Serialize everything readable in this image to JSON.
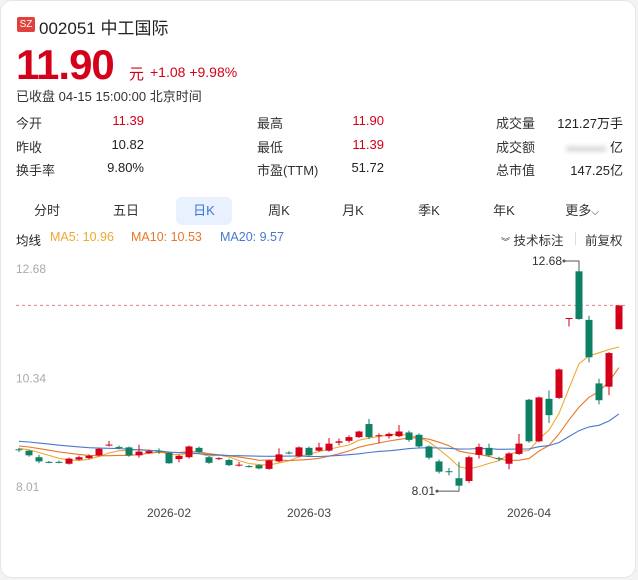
{
  "header": {
    "exchange": "SZ",
    "code": "002051",
    "name": "中工国际",
    "price": "11.90",
    "unit": "元",
    "change": "+1.08",
    "change_pct": "+9.98%",
    "status": "已收盘 04-15 15:00:00 北京时间"
  },
  "stats": [
    {
      "label": "今开",
      "value": "11.39",
      "color": "red"
    },
    {
      "label": "最高",
      "value": "11.90",
      "color": "red"
    },
    {
      "label": "成交量",
      "value": "121.27万手",
      "color": "plain"
    },
    {
      "label": "昨收",
      "value": "10.82",
      "color": "plain"
    },
    {
      "label": "最低",
      "value": "11.39",
      "color": "red"
    },
    {
      "label": "成交额",
      "value": "亿",
      "color": "plain"
    },
    {
      "label": "换手率",
      "value": "9.80%",
      "color": "plain"
    },
    {
      "label": "市盈(TTM)",
      "value": "51.72",
      "color": "plain"
    },
    {
      "label": "总市值",
      "value": "147.25亿",
      "color": "plain"
    }
  ],
  "tabs": [
    "分时",
    "五日",
    "日K",
    "周K",
    "月K",
    "季K",
    "年K",
    "更多"
  ],
  "selected_tab": "日K",
  "ma": {
    "label": "均线",
    "ma5": "MA5: 10.96",
    "ma10": "MA10: 10.53",
    "ma20": "MA20: 9.57",
    "tech": "技术标注",
    "adjust": "前复权"
  },
  "colors": {
    "up": "#d4001a",
    "down": "#0e8064",
    "ma5": "#f0a830",
    "ma10": "#e8782a",
    "ma20": "#4a78d0"
  },
  "chart_data": {
    "type": "candlestick",
    "ylim": [
      7.9,
      12.9
    ],
    "y_ticks": [
      "12.68",
      "10.34",
      "8.01"
    ],
    "x_ticks": [
      {
        "label": "2026-02",
        "index": 15
      },
      {
        "label": "2026-03",
        "index": 29
      },
      {
        "label": "2026-04",
        "index": 51
      }
    ],
    "last_close_line": 11.9,
    "annotations": [
      {
        "label": "12.68",
        "index": 56,
        "value": 12.68
      },
      {
        "label": "8.01",
        "index": 44,
        "value": 8.01
      }
    ],
    "ohlc": [
      [
        8.82,
        8.8,
        8.85,
        8.76
      ],
      [
        8.79,
        8.69,
        8.8,
        8.66
      ],
      [
        8.65,
        8.56,
        8.7,
        8.52
      ],
      [
        8.55,
        8.54,
        8.57,
        8.52
      ],
      [
        8.55,
        8.54,
        8.58,
        8.52
      ],
      [
        8.51,
        8.62,
        8.64,
        8.49
      ],
      [
        8.6,
        8.65,
        8.68,
        8.58
      ],
      [
        8.63,
        8.68,
        8.71,
        8.61
      ],
      [
        8.69,
        8.83,
        8.85,
        8.67
      ],
      [
        8.9,
        8.92,
        9.0,
        8.88
      ],
      [
        8.87,
        8.86,
        8.9,
        8.82
      ],
      [
        8.86,
        8.69,
        8.88,
        8.66
      ],
      [
        8.69,
        8.77,
        8.92,
        8.64
      ],
      [
        8.74,
        8.78,
        8.81,
        8.72
      ],
      [
        8.79,
        8.78,
        8.84,
        8.72
      ],
      [
        8.74,
        8.52,
        8.76,
        8.51
      ],
      [
        8.61,
        8.68,
        8.7,
        8.54
      ],
      [
        8.65,
        8.88,
        8.9,
        8.62
      ],
      [
        8.85,
        8.76,
        8.88,
        8.74
      ],
      [
        8.65,
        8.53,
        8.67,
        8.51
      ],
      [
        8.61,
        8.63,
        8.65,
        8.59
      ],
      [
        8.59,
        8.48,
        8.62,
        8.46
      ],
      [
        8.47,
        8.49,
        8.55,
        8.45
      ],
      [
        8.46,
        8.45,
        8.48,
        8.43
      ],
      [
        8.48,
        8.41,
        8.5,
        8.39
      ],
      [
        8.4,
        8.58,
        8.6,
        8.38
      ],
      [
        8.56,
        8.71,
        8.84,
        8.54
      ],
      [
        8.75,
        8.73,
        8.78,
        8.71
      ],
      [
        8.67,
        8.86,
        8.88,
        8.65
      ],
      [
        8.85,
        8.69,
        8.88,
        8.66
      ],
      [
        8.79,
        8.86,
        8.96,
        8.77
      ],
      [
        8.79,
        8.94,
        9.06,
        8.77
      ],
      [
        8.96,
        8.99,
        9.05,
        8.9
      ],
      [
        9.0,
        9.08,
        9.12,
        8.96
      ],
      [
        9.08,
        9.2,
        9.22,
        9.06
      ],
      [
        9.36,
        9.08,
        9.47,
        9.04
      ],
      [
        9.1,
        9.12,
        9.16,
        8.95
      ],
      [
        9.1,
        9.15,
        9.18,
        9.05
      ],
      [
        9.1,
        9.2,
        9.34,
        9.08
      ],
      [
        9.18,
        9.02,
        9.22,
        8.98
      ],
      [
        9.13,
        8.88,
        9.16,
        8.84
      ],
      [
        8.88,
        8.64,
        8.9,
        8.6
      ],
      [
        8.56,
        8.34,
        8.6,
        8.3
      ],
      [
        8.35,
        8.34,
        8.42,
        8.26
      ],
      [
        8.2,
        8.04,
        8.55,
        8.01
      ],
      [
        8.14,
        8.65,
        8.68,
        8.1
      ],
      [
        8.7,
        8.87,
        8.94,
        8.62
      ],
      [
        8.85,
        8.69,
        8.94,
        8.66
      ],
      [
        8.63,
        8.62,
        8.66,
        8.57
      ],
      [
        8.51,
        8.73,
        8.76,
        8.39
      ],
      [
        8.72,
        8.94,
        9.15,
        8.7
      ],
      [
        9.88,
        8.99,
        9.9,
        8.96
      ],
      [
        8.99,
        9.93,
        9.95,
        8.97
      ],
      [
        9.9,
        9.55,
        10.08,
        9.38
      ],
      [
        9.92,
        10.53,
        10.55,
        9.9
      ],
      [
        11.61,
        11.63,
        11.63,
        11.45
      ],
      [
        12.63,
        11.61,
        12.68,
        11.59
      ],
      [
        11.59,
        10.79,
        11.68,
        10.68
      ],
      [
        10.23,
        9.87,
        10.33,
        9.78
      ],
      [
        10.16,
        10.88,
        10.9,
        9.98
      ],
      [
        11.39,
        11.9,
        11.9,
        11.39
      ]
    ]
  }
}
